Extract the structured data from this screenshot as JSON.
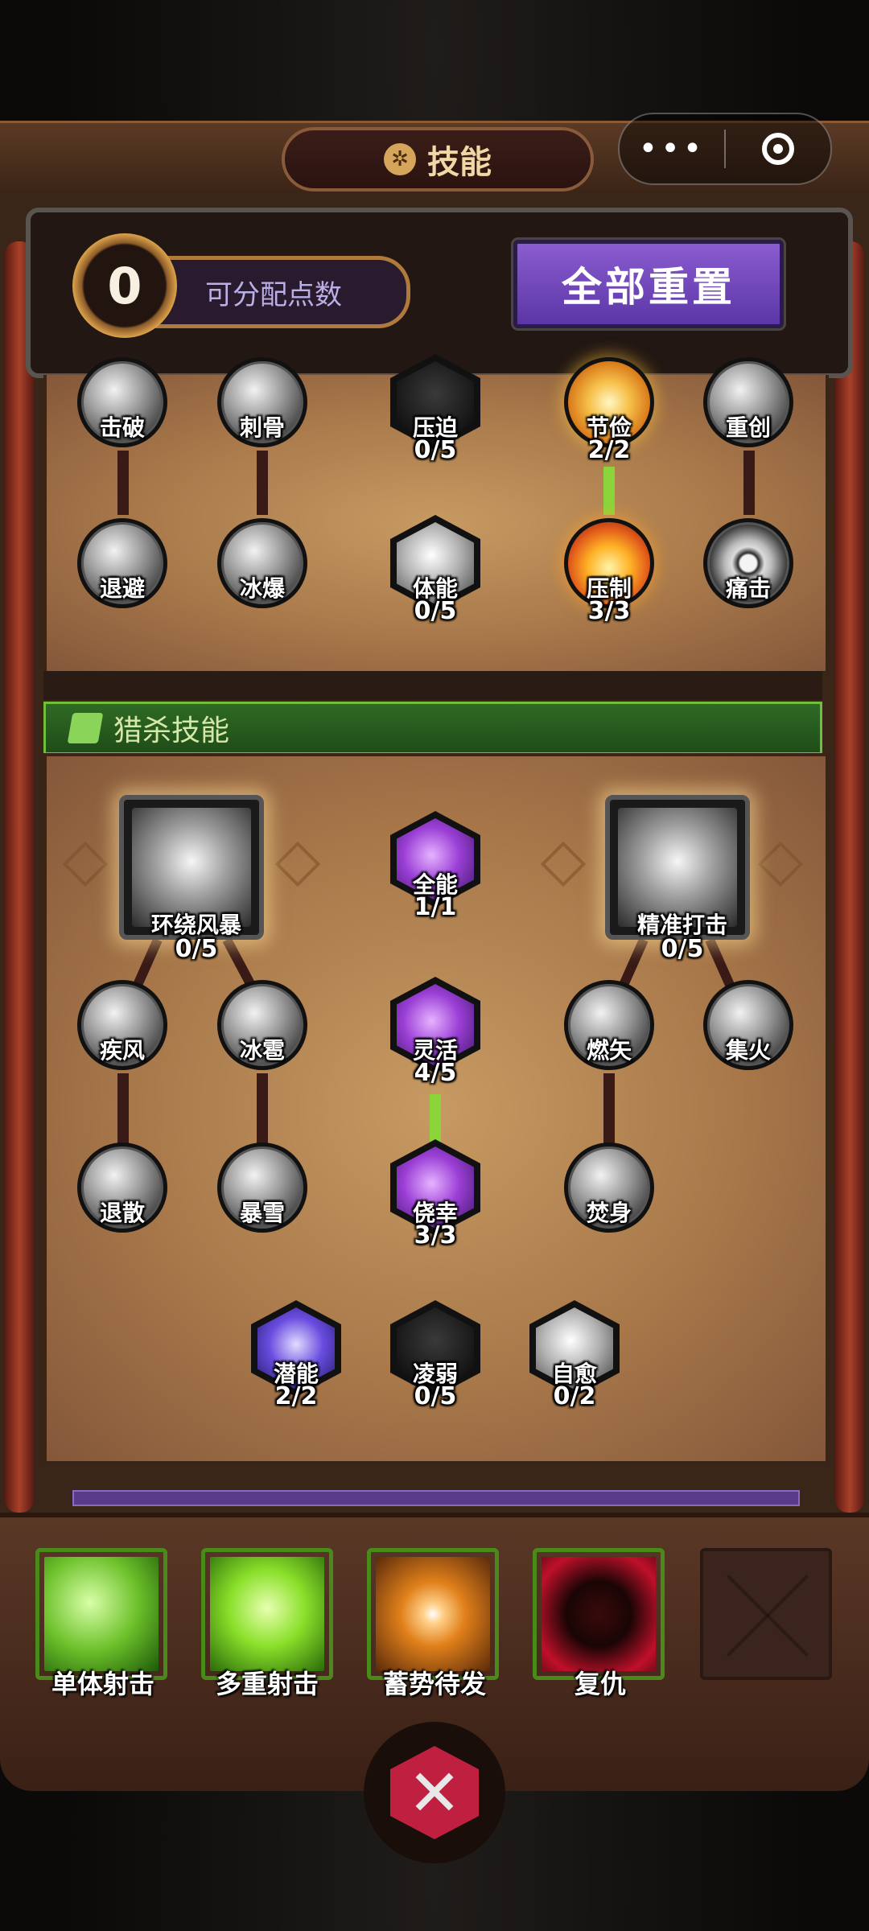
{
  "header": {
    "title": "技能",
    "title_icon": "gear-icon",
    "capsule_more": "•••",
    "capsule_close_icon": "target-circle-icon"
  },
  "points": {
    "value": "0",
    "label": "可分配点数"
  },
  "reset_button": "全部重置",
  "upper_tree": [
    {
      "name": "击破",
      "count": ""
    },
    {
      "name": "刺骨",
      "count": ""
    },
    {
      "name": "压迫",
      "count": "0/5"
    },
    {
      "name": "节俭",
      "count": "2/2"
    },
    {
      "name": "重创",
      "count": ""
    },
    {
      "name": "退避",
      "count": ""
    },
    {
      "name": "冰爆",
      "count": ""
    },
    {
      "name": "体能",
      "count": "0/5"
    },
    {
      "name": "压制",
      "count": "3/3"
    },
    {
      "name": "痛击",
      "count": ""
    }
  ],
  "hunt_section": {
    "title": "猎杀技能",
    "title_icon": "boot-icon",
    "nodes": [
      {
        "name": "环绕风暴",
        "count": "0/5"
      },
      {
        "name": "全能",
        "count": "1/1"
      },
      {
        "name": "精准打击",
        "count": "0/5"
      },
      {
        "name": "疾风",
        "count": ""
      },
      {
        "name": "冰雹",
        "count": ""
      },
      {
        "name": "灵活",
        "count": "4/5"
      },
      {
        "name": "燃矢",
        "count": ""
      },
      {
        "name": "集火",
        "count": ""
      },
      {
        "name": "退散",
        "count": ""
      },
      {
        "name": "暴雪",
        "count": ""
      },
      {
        "name": "侥幸",
        "count": "3/3"
      },
      {
        "name": "焚身",
        "count": ""
      },
      {
        "name": "潜能",
        "count": "2/2"
      },
      {
        "name": "凌弱",
        "count": "0/5"
      },
      {
        "name": "自愈",
        "count": "0/2"
      }
    ]
  },
  "action_slots": [
    {
      "label": "单体射击",
      "icon": "arrow-shot-icon",
      "color": "#5fb82a"
    },
    {
      "label": "多重射击",
      "icon": "multi-shot-icon",
      "color": "#7fd22a"
    },
    {
      "label": "蓄势待发",
      "icon": "charge-orb-icon",
      "color": "#e08a2a"
    },
    {
      "label": "复仇",
      "icon": "revenge-face-icon",
      "color": "#b0142a"
    }
  ],
  "empty_slot_icon": "empty-slot-icon",
  "battle_button_icon": "crossed-swords-icon",
  "colors": {
    "accent_purple": "#6a44b8",
    "hunt_green": "#2f6a25",
    "link_green": "#8bd43a",
    "frame_brown": "#3a2519"
  }
}
